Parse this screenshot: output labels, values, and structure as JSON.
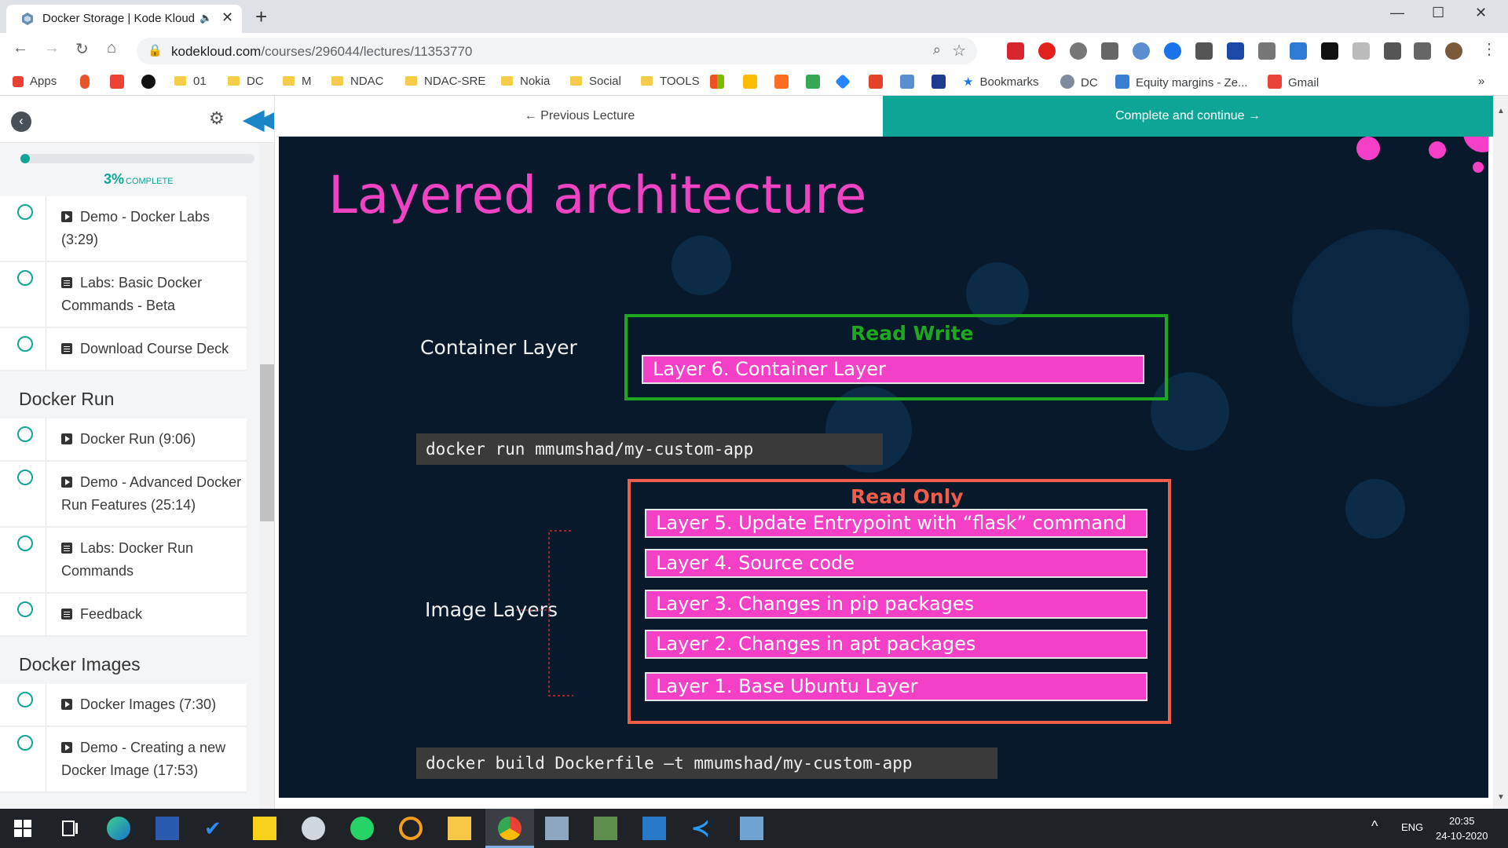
{
  "browser": {
    "tab_title": "Docker Storage | Kode Kloud",
    "url_host": "kodekloud.com",
    "url_path": "/courses/296044/lectures/11353770",
    "bookmarks": [
      "Apps",
      "01",
      "DC",
      "M",
      "NDAC",
      "NDAC-SRE",
      "Nokia",
      "Social",
      "TOOLS",
      "Bookmarks",
      "DC",
      "Equity margins - Ze...",
      "Gmail"
    ]
  },
  "sidebar": {
    "progress_percent": 3,
    "progress_text": "3%",
    "progress_suffix": "COMPLETE",
    "lessons_top": [
      {
        "type": "video",
        "label": "Demo - Docker Labs (3:29)"
      },
      {
        "type": "doc",
        "label": "Labs: Basic Docker Commands - Beta"
      },
      {
        "type": "doc",
        "label": "Download Course Deck"
      }
    ],
    "section_run": "Docker Run",
    "lessons_run": [
      {
        "type": "video",
        "label": "Docker Run (9:06)"
      },
      {
        "type": "video",
        "label": "Demo - Advanced Docker Run Features (25:14)"
      },
      {
        "type": "doc",
        "label": "Labs: Docker Run Commands"
      },
      {
        "type": "doc",
        "label": "Feedback"
      }
    ],
    "section_images": "Docker Images",
    "lessons_images": [
      {
        "type": "video",
        "label": "Docker Images (7:30)"
      },
      {
        "type": "video",
        "label": "Demo - Creating a new Docker Image (17:53)"
      }
    ]
  },
  "lecture_nav": {
    "previous": "← Previous Lecture",
    "complete": "Complete and continue →"
  },
  "slide": {
    "title": "Layered architecture",
    "container_label": "Container Layer",
    "image_label": "Image Layers",
    "read_write": "Read Write",
    "read_only": "Read Only",
    "container_layer": "Layer 6. Container Layer",
    "image_layers": [
      "Layer 5. Update Entrypoint with “flask” command",
      "Layer 4. Source code",
      "Layer 3. Changes in pip packages",
      "Layer 2. Changes in apt packages",
      "Layer 1. Base Ubuntu Layer"
    ],
    "cmd_run": "docker run mmumshad/my-custom-app",
    "cmd_build": "docker build Dockerfile –t mmumshad/my-custom-app",
    "colors": {
      "pink": "#f43fc7",
      "green": "#1fa81f",
      "orange": "#f05d4a",
      "teal": "#0ea597"
    }
  },
  "taskbar": {
    "lang": "ENG",
    "time": "20:35",
    "date": "24-10-2020"
  }
}
